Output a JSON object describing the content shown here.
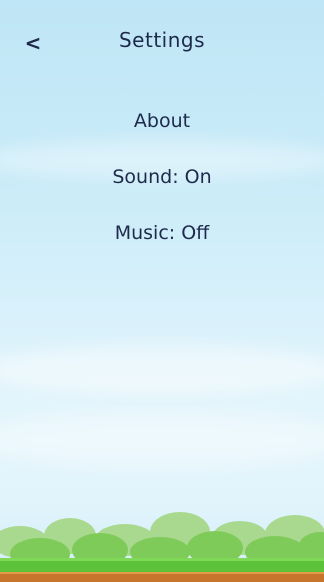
{
  "header": {
    "back_glyph": "<",
    "title": "Settings"
  },
  "menu": {
    "items": [
      {
        "label": "About"
      },
      {
        "label": "Sound: On"
      },
      {
        "label": "Music: Off"
      }
    ]
  },
  "colors": {
    "text": "#1e2a4a",
    "sky_top": "#bfe6f6",
    "grass": "#5cc23a",
    "dirt": "#c7752c"
  },
  "icons": {
    "back": "chevron-left-icon"
  }
}
